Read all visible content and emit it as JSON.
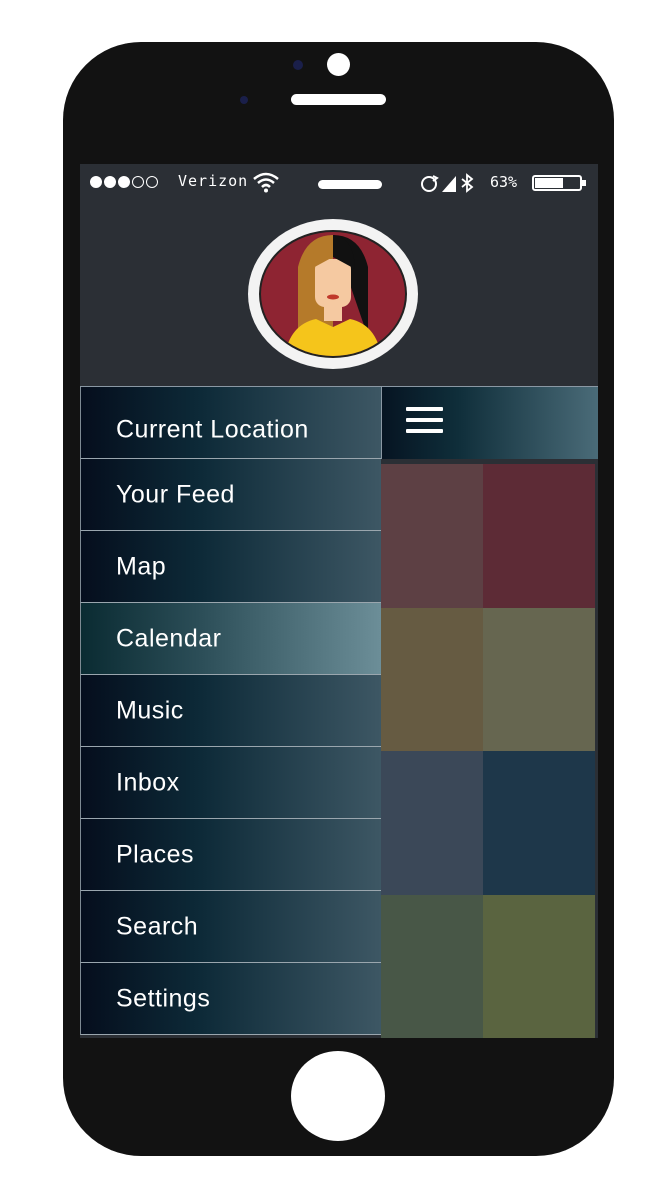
{
  "status_bar": {
    "signal_dots": [
      true,
      true,
      true,
      false,
      false
    ],
    "carrier": "Verizon",
    "battery": "63%",
    "icons": [
      "wifi-icon",
      "rotation-lock-icon",
      "location-icon",
      "bluetooth-icon",
      "battery-icon"
    ]
  },
  "menu": {
    "items": [
      {
        "label": "Current Location"
      },
      {
        "label": "Your Feed"
      },
      {
        "label": "Map"
      },
      {
        "label": "Calendar",
        "active": true
      },
      {
        "label": "Music"
      },
      {
        "label": "Inbox"
      },
      {
        "label": "Places"
      },
      {
        "label": "Search"
      },
      {
        "label": "Settings"
      }
    ]
  },
  "header": {
    "menu_icon": "hamburger-icon"
  },
  "tiles": [
    {
      "color": "#5d4044"
    },
    {
      "color": "#5d2b36"
    },
    {
      "color": "#665b42"
    },
    {
      "color": "#666650"
    },
    {
      "color": "#3b4858"
    },
    {
      "color": "#1e374a"
    },
    {
      "color": "#485747"
    },
    {
      "color": "#5a6440"
    }
  ],
  "colors": {
    "phone_body": "#121212",
    "screen_bg": "#2b2f35",
    "avatar_bg": "#8e2432",
    "avatar_shirt": "#f5c51b",
    "accent_white": "#ffffff"
  }
}
